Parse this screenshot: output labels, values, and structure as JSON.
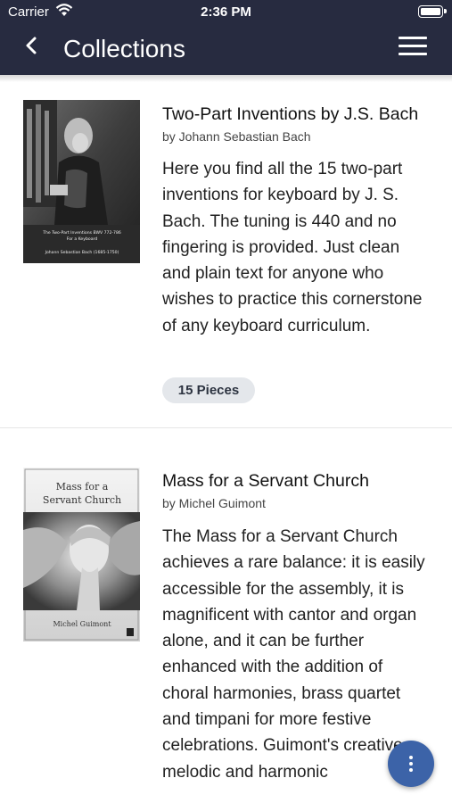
{
  "status_bar": {
    "carrier": "Carrier",
    "time": "2:36 PM"
  },
  "nav": {
    "title": "Collections",
    "back_icon": "chevron-left-icon",
    "menu_icon": "hamburger-menu-icon"
  },
  "collections": [
    {
      "title": "Two-Part Inventions by J.S. Bach",
      "author": "by Johann Sebastian Bach",
      "description": "Here you find all the 15 two-part inventions for keyboard by J. S. Bach. The tuning is 440 and no fingering is provided. Just clean and plain text for anyone who wishes to practice this cornerstone of any keyboard curriculum.",
      "pieces_badge": "15 Pieces",
      "cover": {
        "title": "The Two-Part Inventions BWV 772-786",
        "subtitle": "For a Keyboard",
        "composer": "Johann Sebastian Bach (1685-1750)"
      }
    },
    {
      "title": "Mass for a Servant Church",
      "author": "by Michel Guimont",
      "description": "The Mass for a Servant Church achieves a rare balance: it is easily accessible for the assembly, it is magnificent with cantor and organ alone, and it can be further enhanced with the addition of choral harmonies, brass quartet and timpani for more festive celebrations. Guimont's creative melodic and harmonic",
      "cover": {
        "title_line1": "Mass for a",
        "title_line2": "Servant Church",
        "composer": "Michel Guimont"
      }
    }
  ],
  "fab": {
    "icon": "more-vertical-icon"
  },
  "colors": {
    "header": "#272b40",
    "fab": "#3c63a8",
    "badge": "#e4e7eb"
  }
}
